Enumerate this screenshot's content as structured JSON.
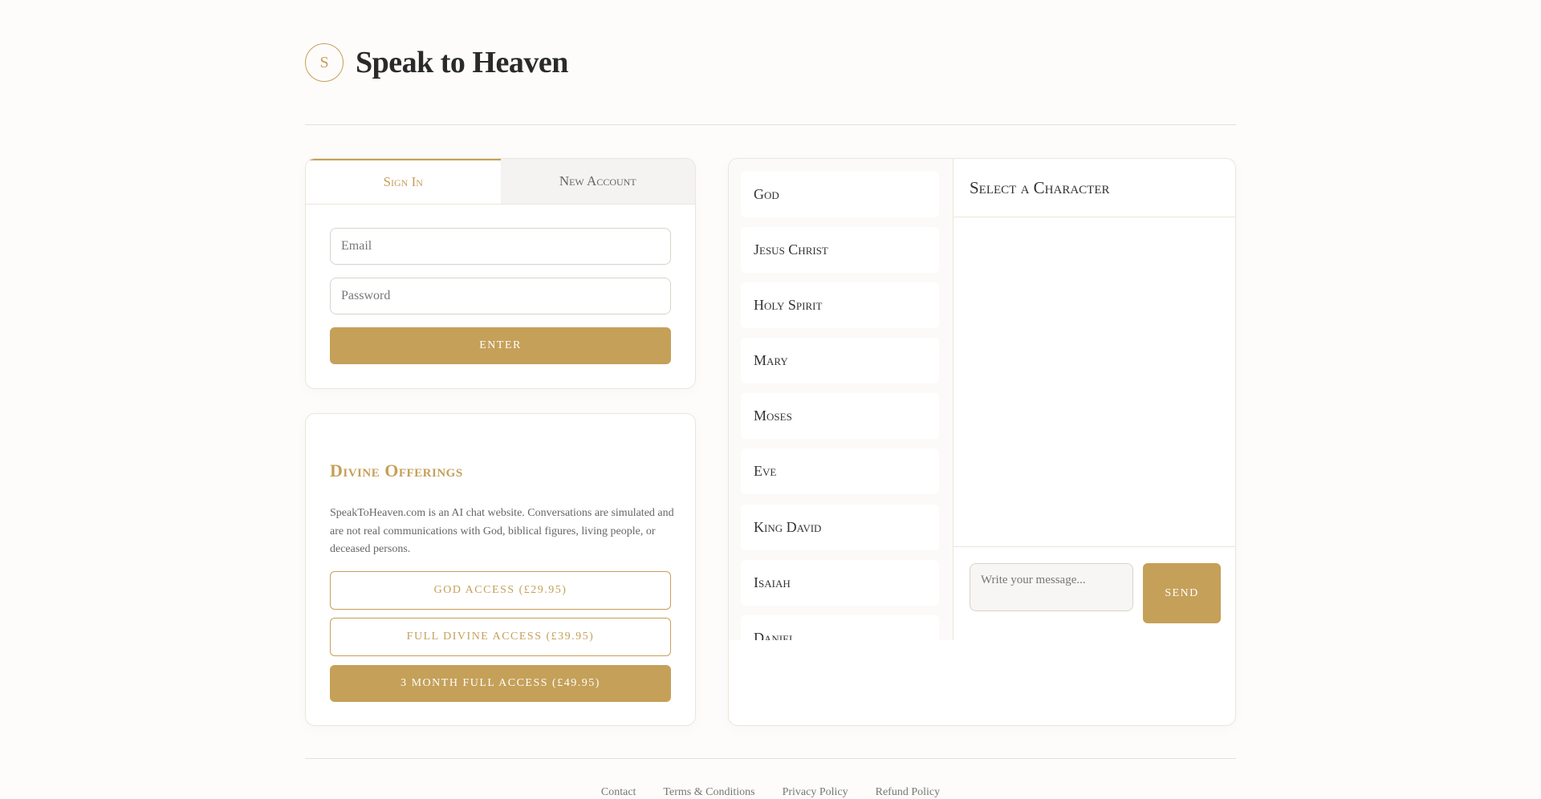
{
  "header": {
    "logo_letter": "S",
    "title": "Speak to Heaven"
  },
  "auth": {
    "tabs": [
      {
        "label": "Sign In",
        "active": true
      },
      {
        "label": "New Account",
        "active": false
      }
    ],
    "email_placeholder": "Email",
    "password_placeholder": "Password",
    "enter_label": "ENTER"
  },
  "offerings": {
    "title": "Divine Offerings",
    "description": "SpeakToHeaven.com is an AI chat website. Conversations are simulated and are not real communications with God, biblical figures, living people, or deceased persons.",
    "buttons": [
      {
        "label": "GOD ACCESS (£29.95)"
      },
      {
        "label": "FULL DIVINE ACCESS (£39.95)"
      },
      {
        "label": "3 MONTH FULL ACCESS (£49.95)"
      }
    ]
  },
  "characters": [
    "God",
    "Jesus Christ",
    "Holy Spirit",
    "Mary",
    "Moses",
    "Eve",
    "King David",
    "Isaiah",
    "Daniel"
  ],
  "chat": {
    "title": "Select a Character",
    "message_placeholder": "Write your message...",
    "send_label": "SEND"
  },
  "footer": {
    "links": [
      "Contact",
      "Terms & Conditions",
      "Privacy Policy",
      "Refund Policy"
    ]
  },
  "colors": {
    "accent": "#c5a059",
    "background": "#fdfcfa"
  }
}
